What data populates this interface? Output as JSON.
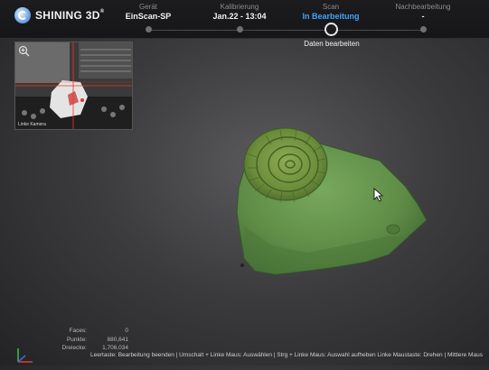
{
  "app": {
    "brand": "SHINING 3D"
  },
  "steps": [
    {
      "label": "Gerät",
      "value": "EinScan-SP",
      "active": false
    },
    {
      "label": "Kalibrierung",
      "value": "Jan.22 - 13:04",
      "active": false
    },
    {
      "label": "Scan",
      "value": "In Bearbeitung",
      "active": true
    },
    {
      "label": "Nachbearbeitung",
      "value": "-",
      "active": false
    }
  ],
  "active_sublabel": "Daten bearbeiten",
  "preview": {
    "camera_label": "Linke Kamera"
  },
  "stats": [
    {
      "label": "Faces:",
      "value": "0"
    },
    {
      "label": "Punkte:",
      "value": "880,641"
    },
    {
      "label": "Dreiecke:",
      "value": "1,706,034"
    }
  ],
  "status_text": "Leertaste: Bearbeitung beenden | Umschalt + Linke Maus: Auswählen | Strg + Linke Maus: Auswahl aufheben Linke Maustaste: Drehen | Mittlere Maus",
  "colors": {
    "accent": "#3ea3ff",
    "model_green": "#5e8f47"
  }
}
